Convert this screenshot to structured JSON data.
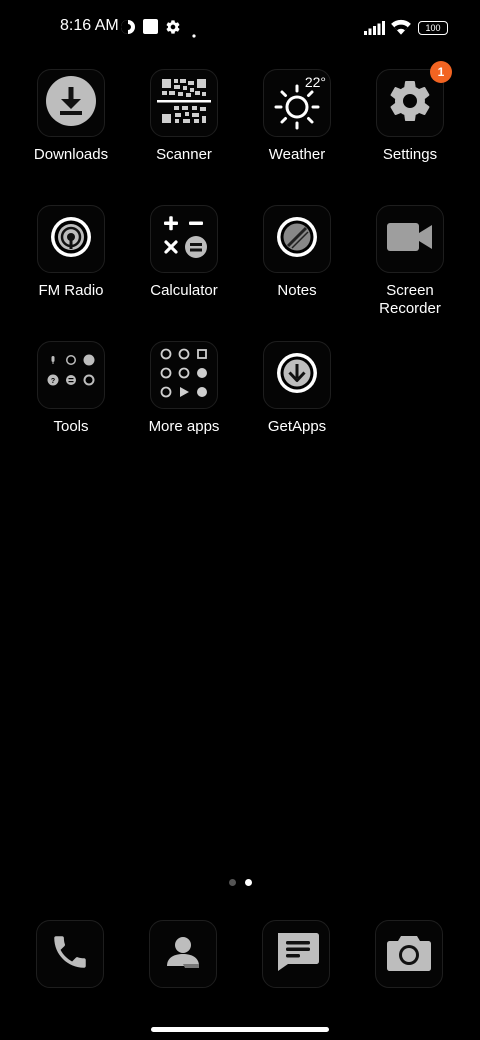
{
  "status_bar": {
    "time": "8:16 AM",
    "battery": "100",
    "icons": [
      "vpn-icon",
      "square-icon",
      "settings-gear-icon",
      "dot-icon",
      "signal-icon",
      "wifi-icon",
      "battery-icon"
    ]
  },
  "apps": [
    {
      "label": "Downloads",
      "icon": "download-icon"
    },
    {
      "label": "Scanner",
      "icon": "qr-code-icon"
    },
    {
      "label": "Weather",
      "icon": "sun-icon",
      "temperature": "22°"
    },
    {
      "label": "Settings",
      "icon": "gear-icon",
      "badge": "1"
    },
    {
      "label": "FM Radio",
      "icon": "radio-icon"
    },
    {
      "label": "Calculator",
      "icon": "calculator-icon"
    },
    {
      "label": "Notes",
      "icon": "notes-icon"
    },
    {
      "label": "Screen Recorder",
      "icon": "video-camera-icon"
    },
    {
      "label": "Tools",
      "icon": "tools-folder-icon"
    },
    {
      "label": "More apps",
      "icon": "more-apps-folder-icon"
    },
    {
      "label": "GetApps",
      "icon": "getapps-icon"
    }
  ],
  "page_indicator": {
    "pages": 2,
    "active": 2
  },
  "dock": [
    {
      "name": "Phone",
      "icon": "phone-icon"
    },
    {
      "name": "Contacts",
      "icon": "contacts-icon"
    },
    {
      "name": "Messages",
      "icon": "messages-icon"
    },
    {
      "name": "Camera",
      "icon": "camera-icon"
    }
  ],
  "colors": {
    "background": "#000000",
    "badge": "#f26422",
    "icon_gray": "#bdbdbd",
    "tile_border": "#1e1e1e"
  }
}
